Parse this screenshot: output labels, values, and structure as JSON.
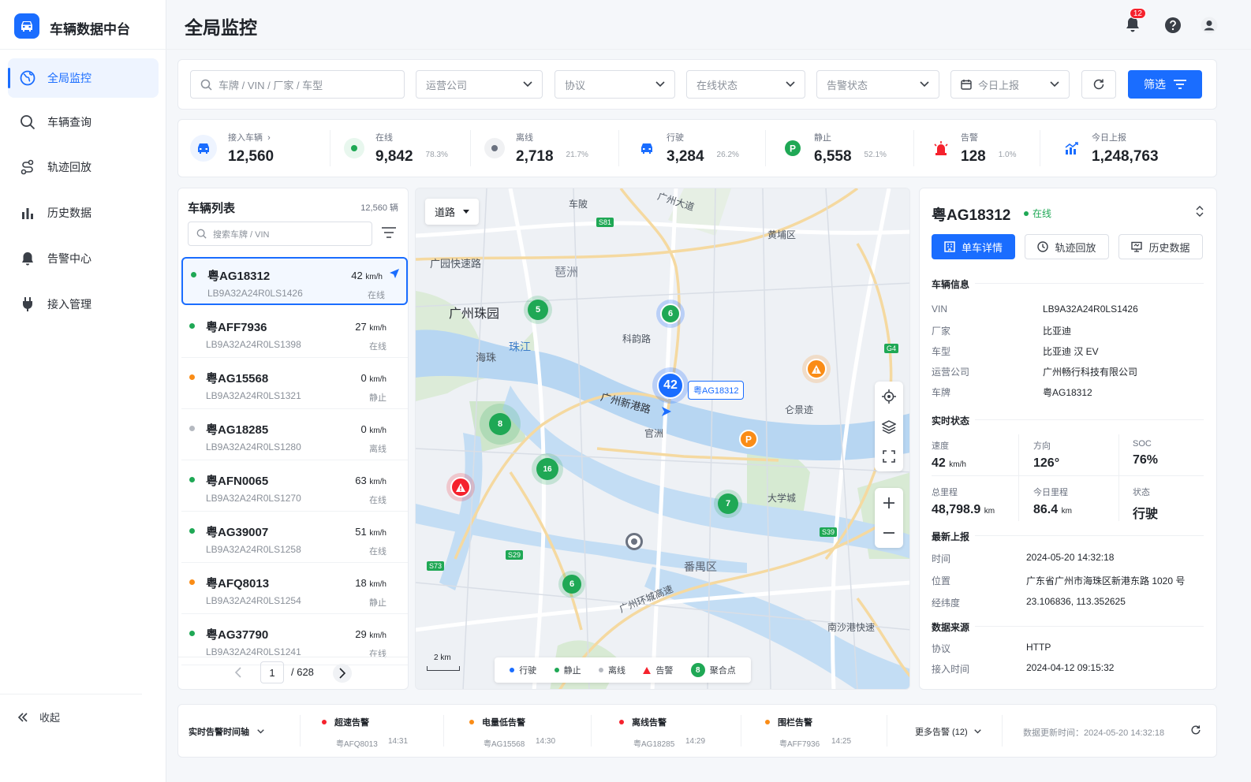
{
  "app": {
    "title": "车辆数据中台"
  },
  "nav": [
    {
      "label": "全局监控",
      "icon": "globe-icon"
    },
    {
      "label": "车辆查询",
      "icon": "search-icon"
    },
    {
      "label": "轨迹回放",
      "icon": "route-icon"
    },
    {
      "label": "历史数据",
      "icon": "bar-chart-icon"
    },
    {
      "label": "告警中心",
      "icon": "bell-icon"
    },
    {
      "label": "接入管理",
      "icon": "plug-icon"
    }
  ],
  "collapse_label": "收起",
  "page_title": "全局监控",
  "header": {
    "notifications": "12"
  },
  "filters": {
    "search_placeholder": "车牌 / VIN / 厂家 / 车型",
    "company": "运营公司",
    "protocol": "协议",
    "online": "在线状态",
    "alarm": "告警状态",
    "date": "今日上报",
    "filter_btn": "筛选"
  },
  "stats": [
    {
      "label": "接入车辆",
      "value": "12,560",
      "pct": ""
    },
    {
      "label": "在线",
      "value": "9,842",
      "pct": "78.3%"
    },
    {
      "label": "离线",
      "value": "2,718",
      "pct": "21.7%"
    },
    {
      "label": "行驶",
      "value": "3,284",
      "pct": "26.2%"
    },
    {
      "label": "静止",
      "value": "6,558",
      "pct": "52.1%"
    },
    {
      "label": "告警",
      "value": "128",
      "pct": "1.0%"
    },
    {
      "label": "今日上报",
      "value": "1,248,763",
      "pct": ""
    }
  ],
  "vehicle_list": {
    "title": "车辆列表",
    "count": "12,560 辆",
    "search_placeholder": "搜索车牌 / VIN",
    "items": [
      {
        "plate": "粤AG18312",
        "vin": "LB9A32A24R0LS1426",
        "speed": "42",
        "status": "在线",
        "color": "#1fa855"
      },
      {
        "plate": "粤AFF7936",
        "vin": "LB9A32A24R0LS1398",
        "speed": "27",
        "status": "在线",
        "color": "#1fa855"
      },
      {
        "plate": "粤AG15568",
        "vin": "LB9A32A24R0LS1321",
        "speed": "0",
        "status": "静止",
        "color": "#fa8c16"
      },
      {
        "plate": "粤AG18285",
        "vin": "LB9A32A24R0LS1280",
        "speed": "0",
        "status": "离线",
        "color": "#b5b9c0"
      },
      {
        "plate": "粤AFN0065",
        "vin": "LB9A32A24R0LS1270",
        "speed": "63",
        "status": "在线",
        "color": "#1fa855"
      },
      {
        "plate": "粤AG39007",
        "vin": "LB9A32A24R0LS1258",
        "speed": "51",
        "status": "在线",
        "color": "#1fa855"
      },
      {
        "plate": "粤AFQ8013",
        "vin": "LB9A32A24R0LS1254",
        "speed": "18",
        "status": "静止",
        "color": "#fa8c16"
      },
      {
        "plate": "粤AG37790",
        "vin": "LB9A32A24R0LS1241",
        "speed": "29",
        "status": "在线",
        "color": "#1fa855"
      }
    ],
    "speed_unit": "km/h",
    "page": "1",
    "total_pages": "/ 628"
  },
  "map": {
    "layer": "道路",
    "scale": "2 km",
    "selected_label": "粤AG18312",
    "cluster_main": "42",
    "places": [
      "车陂",
      "黄埔区",
      "广园快速路",
      "琶洲",
      "广州珠园",
      "科韵路",
      "海珠",
      "珠江",
      "广州新港路",
      "官洲",
      "仑景迹",
      "大学城",
      "番禺区",
      "广州环城高速",
      "南沙港快速",
      "广州大道"
    ],
    "roads": [
      "S81",
      "G4",
      "S39",
      "S73",
      "S29"
    ],
    "clusters": [
      "5",
      "6",
      "8",
      "16",
      "7",
      "6"
    ],
    "legend": [
      "行驶",
      "静止",
      "离线",
      "告警",
      "聚合点"
    ],
    "legend_cluster": "8"
  },
  "detail": {
    "plate": "粤AG18312",
    "status": "在线",
    "tabs": [
      "单车详情",
      "轨迹回放",
      "历史数据"
    ],
    "info_title": "车辆信息",
    "info": [
      {
        "k": "VIN",
        "v": "LB9A32A24R0LS1426"
      },
      {
        "k": "厂家",
        "v": "比亚迪"
      },
      {
        "k": "车型",
        "v": "比亚迪 汉 EV"
      },
      {
        "k": "运营公司",
        "v": "广州畅行科技有限公司"
      },
      {
        "k": "车牌",
        "v": "粤AG18312"
      }
    ],
    "rt_title": "实时状态",
    "rt": [
      {
        "k": "速度",
        "v": "42",
        "u": "km/h"
      },
      {
        "k": "方向",
        "v": "126°",
        "u": ""
      },
      {
        "k": "SOC",
        "v": "76%",
        "u": ""
      },
      {
        "k": "总里程",
        "v": "48,798.9",
        "u": "km"
      },
      {
        "k": "今日里程",
        "v": "86.4",
        "u": "km"
      },
      {
        "k": "状态",
        "v": "行驶",
        "u": ""
      }
    ],
    "report_title": "最新上报",
    "report": [
      {
        "k": "时间",
        "v": "2024-05-20 14:32:18"
      },
      {
        "k": "位置",
        "v": "广东省广州市海珠区新港东路 1020 号"
      },
      {
        "k": "经纬度",
        "v": "23.106836, 113.352625"
      }
    ],
    "source_title": "数据来源",
    "source": [
      {
        "k": "协议",
        "v": "HTTP"
      },
      {
        "k": "接入时间",
        "v": "2024-04-12 09:15:32"
      }
    ]
  },
  "bottom": {
    "timeline_label": "实时告警时间轴",
    "alarms": [
      {
        "title": "超速告警",
        "plate": "粤AFQ8013",
        "time": "14:31",
        "color": "#f5222d"
      },
      {
        "title": "电量低告警",
        "plate": "粤AG15568",
        "time": "14:30",
        "color": "#fa8c16"
      },
      {
        "title": "离线告警",
        "plate": "粤AG18285",
        "time": "14:29",
        "color": "#f5222d"
      },
      {
        "title": "围栏告警",
        "plate": "粤AFF7936",
        "time": "14:25",
        "color": "#fa8c16"
      }
    ],
    "more": "更多告警 (12)",
    "update": "数据更新时间：2024-05-20 14:32:18"
  },
  "colors": {
    "primary": "#1a6dff",
    "online": "#1fa855",
    "offline": "#b5b9c0",
    "idle": "#fa8c16",
    "alarm": "#f5222d"
  }
}
